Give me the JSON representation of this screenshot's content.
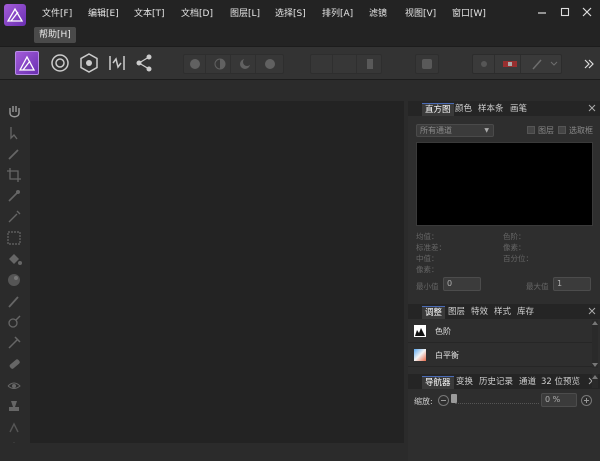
{
  "menu": {
    "file": "文件[F]",
    "edit": "编辑[E]",
    "text": "文本[T]",
    "document": "文档[D]",
    "layer": "图层[L]",
    "select": "选择[S]",
    "arrange": "排列[A]",
    "filter": "滤镜",
    "view": "视图[V]",
    "window": "窗口[W]",
    "help": "帮助[H]"
  },
  "toolbar": {
    "personas": [
      "photo-persona",
      "liquify-persona",
      "develop-persona",
      "tone-mapping-persona",
      "export-persona"
    ]
  },
  "histogram_panel": {
    "tabs": [
      "直方图",
      "颜色",
      "样本条",
      "画笔"
    ],
    "active_tab": "直方图",
    "channel_select": "所有通道",
    "layer_checkbox": "图层",
    "selection_checkbox": "选取框",
    "stats_left": [
      "均值：",
      "标准差：",
      "中值：",
      "像素："
    ],
    "stats_right": [
      "色阶：",
      "像素：",
      "百分位："
    ],
    "min_label": "最小值",
    "min_value": "0",
    "max_label": "最大值",
    "max_value": "1"
  },
  "adjustments_panel": {
    "tabs": [
      "调整",
      "图层",
      "特效",
      "样式",
      "库存"
    ],
    "active_tab": "调整",
    "items": [
      {
        "label": "色阶",
        "icon": "levels-icon"
      },
      {
        "label": "白平衡",
        "icon": "white-balance-icon"
      }
    ]
  },
  "navigator_panel": {
    "tabs": [
      "导航器",
      "变换",
      "历史记录",
      "通道",
      "32 位预览"
    ],
    "active_tab": "导航器",
    "zoom_label": "缩放:",
    "zoom_value": "0 %",
    "zoom_fraction": 0
  },
  "colors": {
    "accent": "#8a4fd0",
    "panel_bg": "#2e2e2e",
    "canvas_bg": "#232323"
  }
}
